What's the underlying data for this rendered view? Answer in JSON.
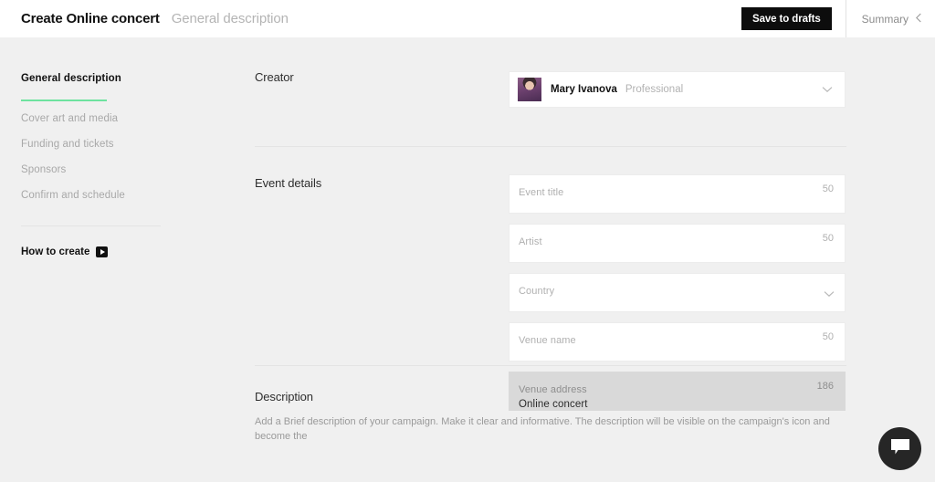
{
  "header": {
    "title": "Create Online concert",
    "subtitle": "General description",
    "save_label": "Save to drafts",
    "summary_label": "Summary"
  },
  "sidebar": {
    "items": [
      {
        "label": "General description",
        "active": true
      },
      {
        "label": "Cover art and media",
        "active": false
      },
      {
        "label": "Funding and tickets",
        "active": false
      },
      {
        "label": "Sponsors",
        "active": false
      },
      {
        "label": "Confirm and schedule",
        "active": false
      }
    ],
    "how_to_create": "How to create"
  },
  "main": {
    "creator": {
      "section_title": "Creator",
      "name": "Mary Ivanova",
      "role": "Professional"
    },
    "event_details": {
      "section_title": "Event details",
      "fields": [
        {
          "label": "Event title",
          "value": "",
          "counter": "50",
          "type": "text"
        },
        {
          "label": "Artist",
          "value": "",
          "counter": "50",
          "type": "text"
        },
        {
          "label": "Country",
          "value": "",
          "counter": "",
          "type": "select"
        },
        {
          "label": "Venue name",
          "value": "",
          "counter": "50",
          "type": "text"
        },
        {
          "label": "Venue address",
          "value": "Online concert",
          "counter": "186",
          "type": "disabled"
        }
      ]
    },
    "description": {
      "section_title": "Description",
      "helper_text": "Add a Brief description of your campaign. Make it clear and informative. The description will be visible on the campaign's icon and become the"
    }
  },
  "colors": {
    "accent_green": "#6ee3a0",
    "button_black": "#0d0d0d",
    "page_bg": "#f0f0f0",
    "disabled_field": "#d9d9d9"
  }
}
